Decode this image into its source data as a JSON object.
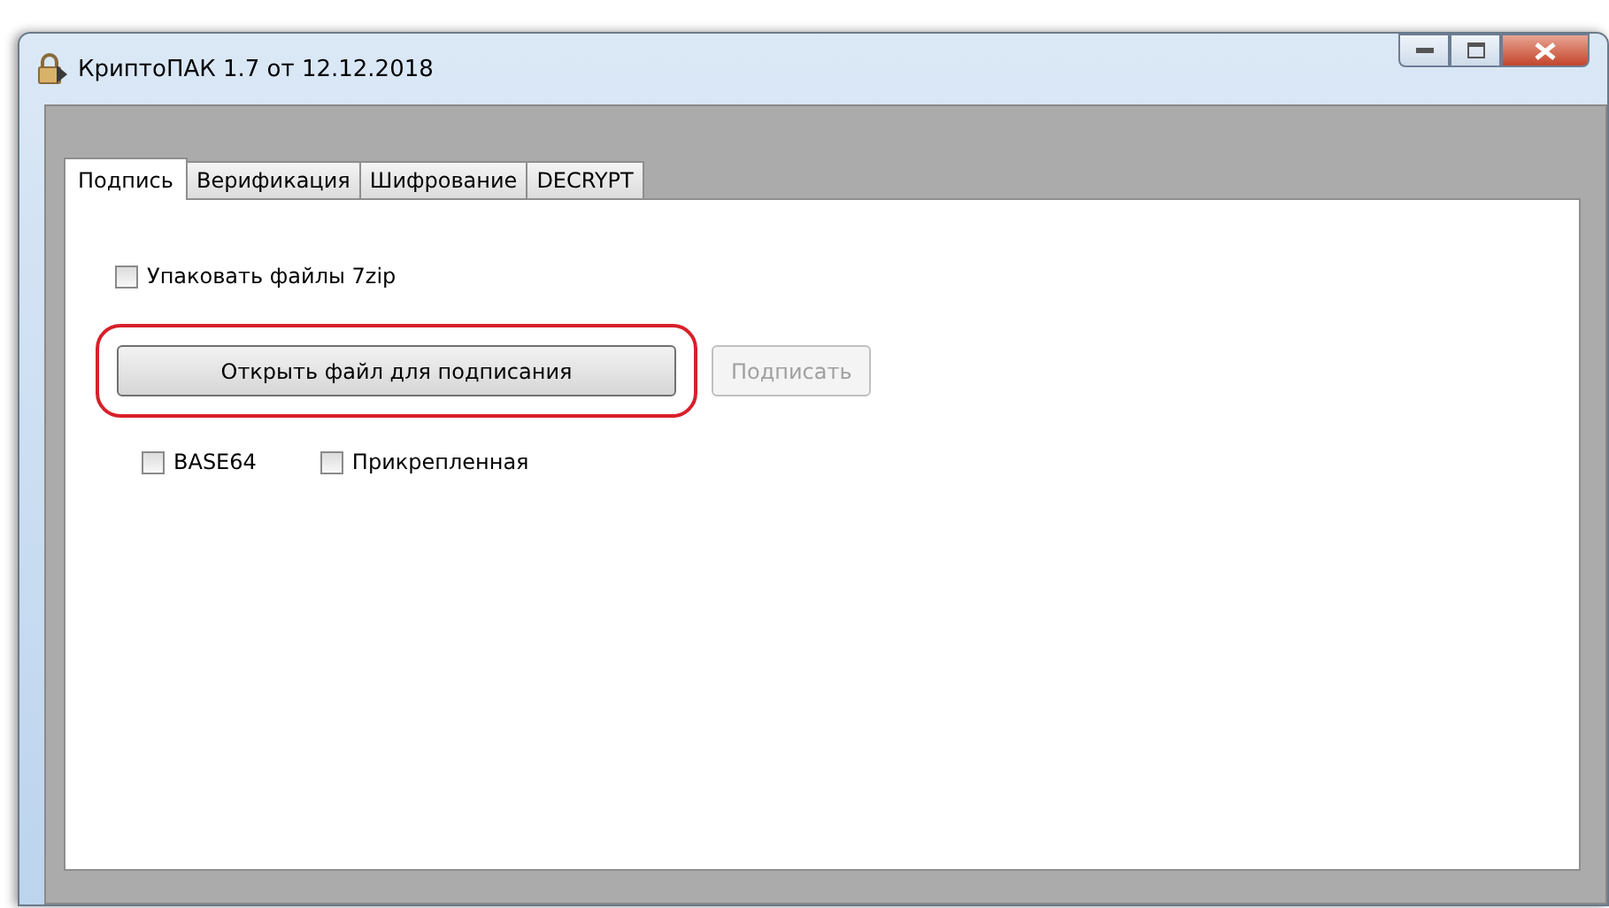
{
  "window": {
    "title": "КриптоПАК 1.7 от 12.12.2018"
  },
  "tabs": [
    {
      "label": "Подпись",
      "selected": true
    },
    {
      "label": "Верификация",
      "selected": false
    },
    {
      "label": "Шифрование",
      "selected": false
    },
    {
      "label": "DECRYPT",
      "selected": false
    }
  ],
  "pack_option": {
    "label": "Упаковать файлы 7zip",
    "checked": false
  },
  "buttons": [
    {
      "label": "Открыть файл для подписания",
      "disabled": false,
      "highlighted": true
    },
    {
      "label": "Подписать",
      "disabled": true,
      "highlighted": false
    }
  ],
  "options": [
    {
      "label": "BASE64",
      "checked": false
    },
    {
      "label": "Прикрепленная",
      "checked": false
    }
  ]
}
